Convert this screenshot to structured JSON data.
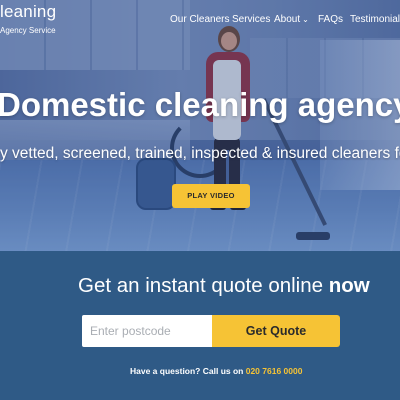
{
  "brand": {
    "logo_text": "leaning",
    "logo_sub": "Agency Service"
  },
  "nav": {
    "items": [
      {
        "label": "Our Cleaners"
      },
      {
        "label": "Services"
      },
      {
        "label": "About"
      },
      {
        "label": "FAQs"
      },
      {
        "label": "Testimonials"
      }
    ],
    "about_chevron": "⌄"
  },
  "hero": {
    "title": "Domestic cleaning agency servi",
    "subtitle": "y vetted, screened, trained, inspected & insured cleaners for Grea",
    "play_label": "PLAY VIDEO"
  },
  "quote": {
    "title_prefix": "Get an instant quote online ",
    "title_bold": "now",
    "postcode_placeholder": "Enter postcode",
    "button_label": "Get Quote",
    "question_text": "Have a question? Call us on ",
    "phone": "020 7616 0000"
  },
  "colors": {
    "accent_yellow": "#f6c335",
    "section_blue": "#2f5a86",
    "hero_overlay_blue": "#4d69a0"
  }
}
